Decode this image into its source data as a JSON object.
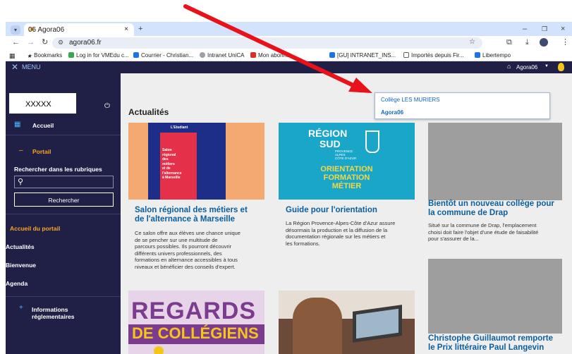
{
  "browser": {
    "tab_title": "06 Agora06",
    "url": "agora06.fr",
    "bookmarks": [
      {
        "label": "Bookmarks",
        "color": "#202124"
      },
      {
        "label": "Log in for VMEdu c...",
        "color": "#34a853"
      },
      {
        "label": "Courrier - Christian...",
        "color": "#1a73e8"
      },
      {
        "label": "Intranet UniCA",
        "color": "#5f6368"
      },
      {
        "label": "Mon abonne",
        "color": "#d93025"
      },
      {
        "label": "[GU] INTRANET_INS...",
        "color": "#1a73e8"
      },
      {
        "label": "Importés depuis Fir...",
        "color": "#5f6368"
      },
      {
        "label": "Libertempo",
        "color": "#1a73e8"
      }
    ]
  },
  "topbar": {
    "menu_label": "MENU",
    "site_label": "Agora06",
    "dropdown": [
      "Collège LES MURIERS",
      "Agora06"
    ]
  },
  "sidebar": {
    "username": "XXXXX",
    "home": "Accueil",
    "portal": "Portail",
    "search_heading": "Rechercher dans les rubriques",
    "search_button": "Rechercher",
    "links": [
      "Accueil du portail",
      "Actualités",
      "Bienvenue",
      "Agenda"
    ],
    "info_label_1": "Informations",
    "info_label_2": "réglementaires"
  },
  "main": {
    "heading": "Actualités",
    "cards": [
      {
        "title_1": "Salon régional des métiers et",
        "title_2": "de l'alternance à Marseille",
        "text": [
          "Ce salon offre aux élèves une chance unique",
          "de se pencher sur une multitude de",
          "parcours possibles. Ils pourront découvrir",
          "différents univers professionnels, des",
          "formations en alternance accessibles à tous",
          "niveaux et bénéficier des conseils d'expert."
        ],
        "poster_lines": [
          "Salon",
          "régional",
          "des",
          "métiers",
          "et de",
          "l'alternance",
          "à Marseille"
        ]
      },
      {
        "title": "Guide pour l'orientation",
        "text": [
          "La Région Provence-Alpes-Côte d'Azur assure",
          "désormais la production et la diffusion de la",
          "documentation régionale sur les métiers et",
          "les formations."
        ],
        "poster_top": "RÉGION",
        "poster_sub": "SUD",
        "poster_region": [
          "PROVENCE",
          "ALPES",
          "CÔTE D'AZUR"
        ],
        "poster_lines": [
          "ORIENTATION",
          "FORMATION",
          "MÉTIER"
        ]
      },
      {
        "title_1": "Bientôt un nouveau collège pour",
        "title_2": "la commune de Drap",
        "text": [
          "Situé sur la commune de Drap, l'emplacement",
          "choisi doit faire l'objet d'une étude de faisabilité",
          "pour s'assurer de la..."
        ]
      },
      {
        "title_1": "Christophe Guillaumot remporte",
        "title_2": "le Prix littéraire Paul Langevin"
      }
    ],
    "regards_1": "REGARDS",
    "regards_2": "DE COLLÉGIENS"
  },
  "colors": {
    "navy": "#202046",
    "accent_orange": "#f5a623",
    "link_blue": "#0b5fa0",
    "arrow_red": "#e8121b"
  }
}
